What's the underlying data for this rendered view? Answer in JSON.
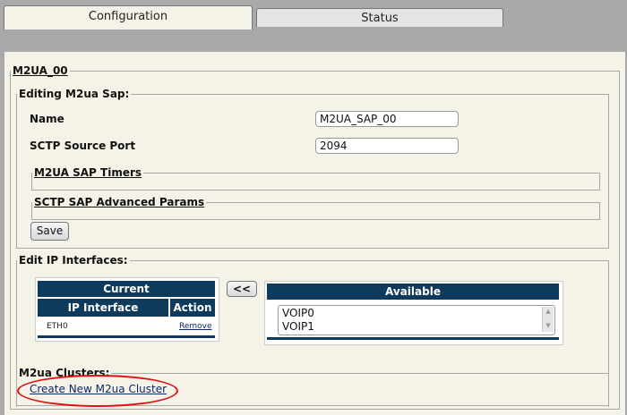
{
  "tabs": [
    {
      "label": "Configuration",
      "active": true
    },
    {
      "label": "Status",
      "active": false
    }
  ],
  "m2ua": {
    "legend": "M2UA_00",
    "sap": {
      "legend": "Editing M2ua Sap:",
      "name_label": "Name",
      "name_value": "M2UA_SAP_00",
      "port_label": "SCTP Source Port",
      "port_value": "2094",
      "timers_legend": "M2UA SAP Timers",
      "advanced_legend": "SCTP SAP Advanced Params",
      "save_label": "Save"
    },
    "ip": {
      "legend": "Edit IP Interfaces:",
      "current_title": "Current",
      "col_interface": "IP Interface",
      "col_action": "Action",
      "rows": [
        {
          "interface": "ETH0",
          "action": "Remove"
        }
      ],
      "move_label": "<<",
      "available_title": "Available",
      "available_options": [
        "VOIP0",
        "VOIP1"
      ]
    },
    "clusters": {
      "legend": "M2ua Clusters:",
      "create_link": "Create New M2ua Cluster"
    }
  },
  "colors": {
    "header": "#0e3a5c",
    "highlight": "#dd1111",
    "background": "#f5f2e8"
  }
}
